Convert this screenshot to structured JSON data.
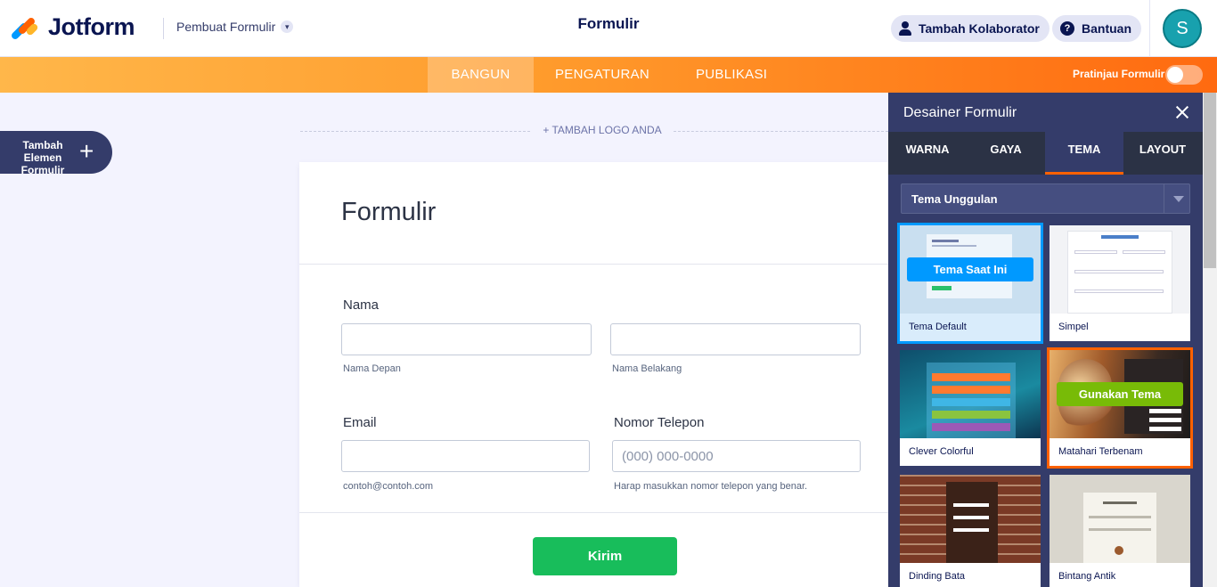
{
  "header": {
    "brand": "Jotform",
    "builder_menu": "Pembuat Formulir",
    "title": "Formulir",
    "add_collaborator": "Tambah Kolaborator",
    "help": "Bantuan",
    "avatar_initial": "S"
  },
  "tabs": [
    "BANGUN",
    "PENGATURAN",
    "PUBLIKASI"
  ],
  "active_tab": "BANGUN",
  "preview_label": "Pratinjau Formulir",
  "add_element": "Tambah Elemen Formulir",
  "add_logo": "+ TAMBAH LOGO ANDA",
  "form": {
    "title": "Formulir",
    "name_label": "Nama",
    "first_name_hint": "Nama Depan",
    "last_name_hint": "Nama Belakang",
    "email_label": "Email",
    "email_hint": "contoh@contoh.com",
    "phone_label": "Nomor Telepon",
    "phone_placeholder": "(000) 000-0000",
    "phone_hint": "Harap masukkan nomor telepon yang benar.",
    "submit": "Kirim"
  },
  "panel": {
    "title": "Desainer Formulir",
    "tabs": [
      "WARNA",
      "GAYA",
      "TEMA",
      "LAYOUT"
    ],
    "active_tab": "TEMA",
    "dropdown": "Tema Unggulan",
    "current_theme_label": "Tema Saat Ini",
    "use_theme_label": "Gunakan Tema",
    "themes": [
      "Tema Default",
      "Simpel",
      "Clever Colorful",
      "Matahari Terbenam",
      "Dinding Bata",
      "Bintang Antik"
    ]
  },
  "colors": {
    "navy": "#0a1551",
    "orange": "#ff6100",
    "panel": "#343c6a",
    "green": "#18bd5b",
    "selected_blue": "#0099ff"
  }
}
